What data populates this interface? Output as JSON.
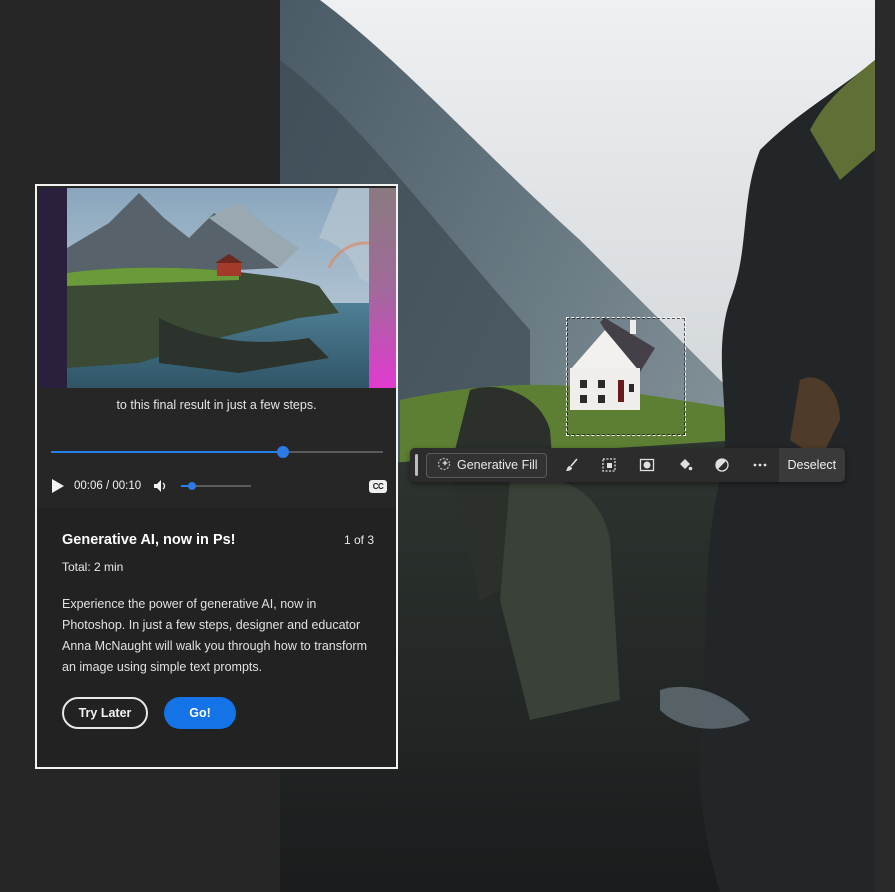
{
  "tutorial": {
    "caption": "to this final result in just a few steps.",
    "time_display": "00:06 / 00:10",
    "playback_progress": 0.7,
    "volume_level": 0.15,
    "cc_label": "CC",
    "title": "Generative AI, now in Ps!",
    "step_counter": "1 of 3",
    "total": "Total: 2 min",
    "description": "Experience the power of generative AI, now in Photoshop. In just a few steps, designer and educator Anna McNaught will walk you through how to transform an image using simple text prompts.",
    "try_later_label": "Try Later",
    "go_label": "Go!"
  },
  "taskbar": {
    "generative_fill_label": "Generative Fill",
    "icons": [
      "brush-icon",
      "select-subject-icon",
      "mask-icon",
      "fill-icon",
      "adjustment-icon",
      "more-icon"
    ],
    "deselect_label": "Deselect"
  },
  "colors": {
    "accent": "#1473e6",
    "panel_bg": "#222222",
    "app_bg": "#262626"
  }
}
